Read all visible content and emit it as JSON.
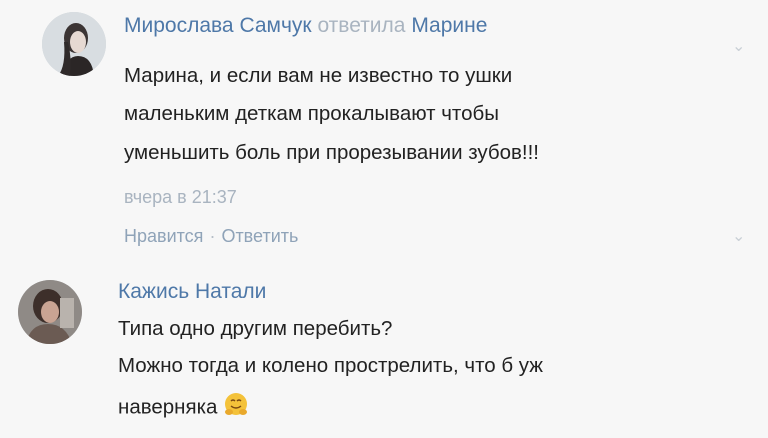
{
  "comments": [
    {
      "author": "Мирослава Самчук",
      "reply_word": "ответила",
      "reply_to": "Марине",
      "lines": [
        "Марина, и если вам не известно то ушки",
        "маленьким деткам прокалывают чтобы",
        "уменьшить боль при прорезывании зубов!!!"
      ],
      "time": "вчера в 21:37",
      "like_label": "Нравится",
      "separator": "·",
      "reply_label": "Ответить"
    },
    {
      "author": "Кажись Натали",
      "lines": [
        "Типа одно другим перебить?",
        "Можно тогда и колено прострелить, что б уж",
        "наверняка"
      ],
      "emoji": "smiling-face-with-hugging-hands"
    }
  ],
  "colors": {
    "author": "#4e78a8",
    "muted": "#a9b4c0",
    "text": "#222222",
    "background": "#f7f7f7"
  }
}
